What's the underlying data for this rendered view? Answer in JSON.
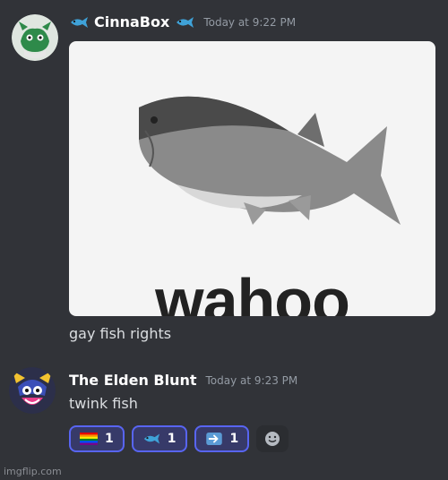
{
  "messages": [
    {
      "username": "CinnaBox",
      "timestamp": "Today at 9:22 PM",
      "image_caption": "wahoo",
      "text": "gay fish rights"
    },
    {
      "username": "The Elden Blunt",
      "timestamp": "Today at 9:23 PM",
      "text": "twink fish"
    }
  ],
  "reactions": [
    {
      "emoji": "rainbow-flag",
      "count": "1"
    },
    {
      "emoji": "fish",
      "count": "1"
    },
    {
      "emoji": "right-arrow",
      "count": "1"
    }
  ],
  "watermark": "imgflip.com",
  "colors": {
    "background": "#313338",
    "username": "#ffffff",
    "timestamp": "#949ba4",
    "reaction_bg": "#373a69",
    "reaction_border": "#5865f2"
  }
}
